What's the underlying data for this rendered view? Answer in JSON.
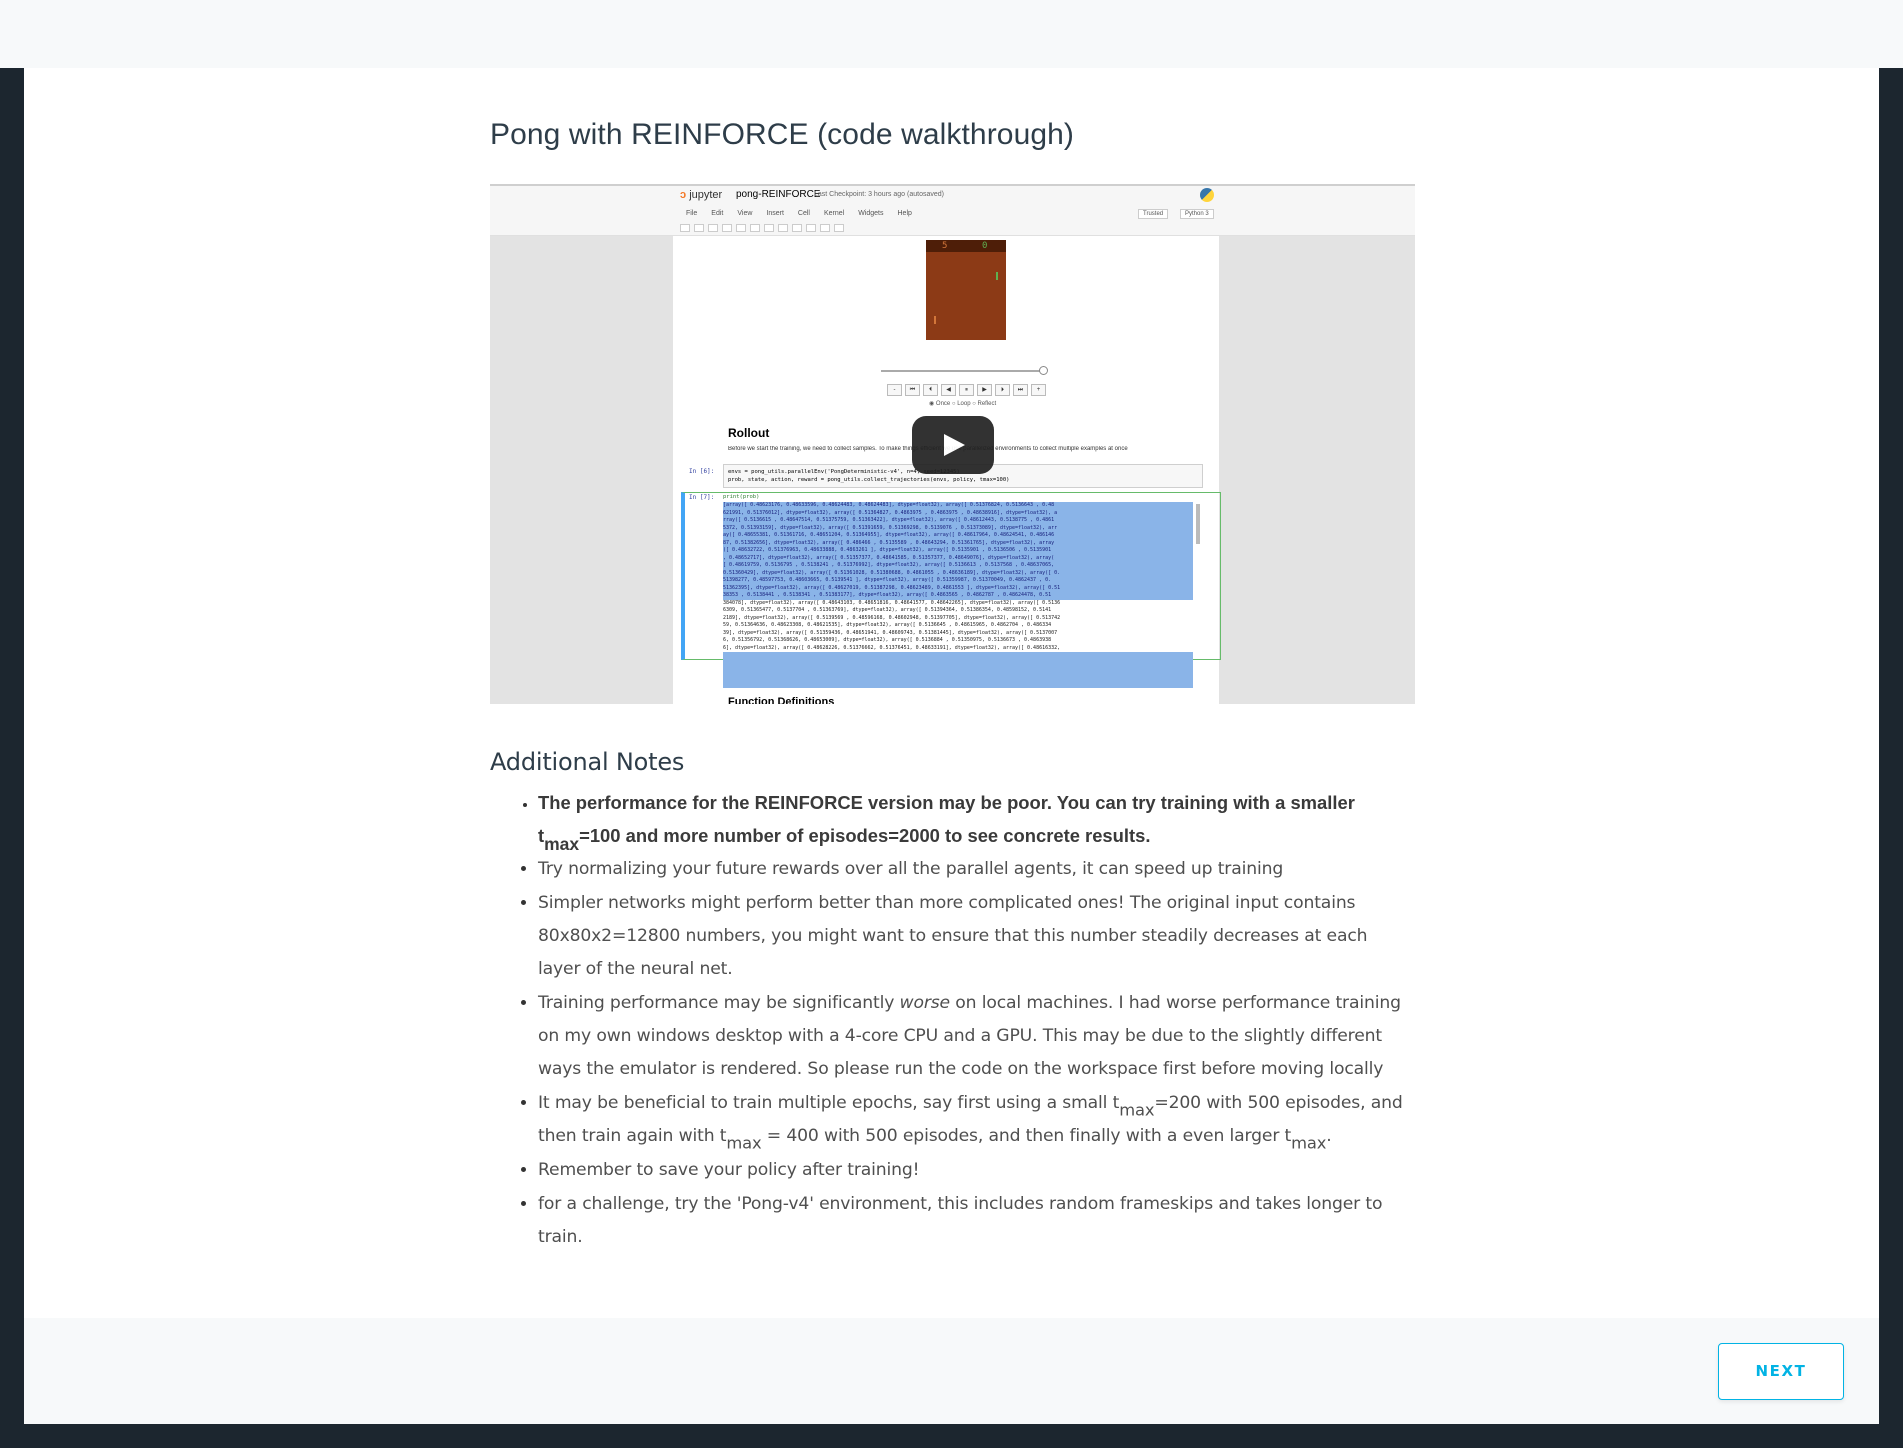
{
  "lesson": {
    "title": "Pong with REINFORCE (code walkthrough)"
  },
  "video": {
    "notebook": {
      "logo_text": "jupyter",
      "name": "pong-REINFORCE",
      "checkpoint": "Last Checkpoint: 3 hours ago  (autosaved)",
      "menu": [
        "File",
        "Edit",
        "View",
        "Insert",
        "Cell",
        "Kernel",
        "Widgets",
        "Help"
      ],
      "trusted": "Trusted",
      "kernel": "Python 3",
      "score_left": "5",
      "score_right": "0",
      "loop_options": "◉ Once ○ Loop ○ Reflect",
      "rollout_heading": "Rollout",
      "rollout_desc": "Before we start the training, we need to collect samples. To make things efficient we use parallelized environments to collect multiple examples at once",
      "cell4_prompt": "In [6]:",
      "cell4_line1": "envs = pong_utils.parallelEnv('PongDeterministic-v4', n=4, seed=12345)",
      "cell4_line2": "prob, state, action, reward = pong_utils.collect_trajectories(envs, policy, tmax=100)",
      "cell7_prompt": "In [7]:",
      "cell7_code": "print(prob)",
      "output_lines": [
        "[array([ 0.48623176,  0.48633596,  0.48624483,  0.48624483], dtype=float32), array([ 0.51376824,  0.5136643 ,  0.48",
        "621991,  0.51376012], dtype=float32), array([ 0.51364827,  0.4863975 ,  0.4863975 ,  0.48638916], dtype=float32), a",
        "rray([ 0.5136615 ,  0.48647514,  0.51375759,  0.51363422], dtype=float32), array([ 0.48612443,  0.5138775 ,  0.4861",
        "5372,  0.51393159], dtype=float32), array([ 0.51391659,  0.51369298,  0.5139076 ,  0.51373089], dtype=float32), arr",
        "ay([ 0.48655381,  0.51361716,  0.48651204,  0.51364955], dtype=float32), array([ 0.48617964,  0.48624541,  0.486146",
        "87,  0.51382656], dtype=float32), array([ 0.486466  ,  0.5135589 ,  0.48643294,  0.51361765], dtype=float32), array",
        "([ 0.48632722,  0.51376963,  0.48633888,  0.4863261 ], dtype=float32), array([ 0.5135901 ,  0.5136506 ,  0.5135901",
        ",  0.48652717], dtype=float32), array([ 0.51357377,  0.48641585,  0.51357377,  0.48649076], dtype=float32), array(",
        "[ 0.48619759,  0.5136795 ,  0.5138241 ,  0.51376992], dtype=float32), array([ 0.5136613 ,  0.5137568 ,  0.48637065,",
        "  0.51360429], dtype=float32), array([ 0.51361028,  0.51380688,  0.4861055 ,  0.48636189], dtype=float32), array([ 0.",
        "51398277,  0.48597753,  0.48603665,  0.5139541 ], dtype=float32), array([ 0.51359987,  0.51370049,  0.4862437 ,  0.",
        "51362395], dtype=float32), array([ 0.48627019,  0.51387298,  0.48623489,  0.4861553 ], dtype=float32), array([ 0.51",
        "38353 ,  0.5138441 ,  0.5138341 ,  0.51383177], dtype=float32), array([ 0.4863565 ,  0.4862787 ,  0.48624478,  0.51",
        "384078], dtype=float32), array([ 0.48643103,  0.48651816,  0.48641577,  0.48642265], dtype=float32), array([ 0.5136",
        "6309,  0.51365477,  0.5137704 ,  0.51363769], dtype=float32), array([ 0.51394364,  0.51386354,  0.48598152,  0.5141",
        "2189], dtype=float32), array([ 0.5139569 ,  0.48596168,  0.48602948,  0.51397705], dtype=float32), array([ 0.513742",
        "59,  0.51364636,  0.48623308,  0.48621535], dtype=float32), array([ 0.5136645 ,  0.48615965,  0.4862704 ,  0.486334",
        "39], dtype=float32), array([ 0.51359436,  0.48651941,  0.48609743,  0.51381445], dtype=float32), array([ 0.5137007",
        "6,  0.51356792,  0.51368626,  0.48653009], dtype=float32), array([ 0.5136884 ,  0.51350975,  0.5136673 ,  0.4863938",
        "6], dtype=float32), array([ 0.48628226,  0.51376662,  0.51376451,  0.48633191], dtype=float32), array([ 0.48616332,"
      ],
      "function_heading": "Function Definitions"
    }
  },
  "notes": {
    "heading": "Additional Notes",
    "items": [
      {
        "pre": "The performance for the REINFORCE version may be poor. You can try training with a smaller t",
        "sub1": "max",
        "post": "=100 and more number of episodes=2000 to see concrete results."
      },
      {
        "text": "Try normalizing your future rewards over all the parallel agents, it can speed up training"
      },
      {
        "text": "Simpler networks might perform better than more complicated ones! The original input contains 80x80x2=12800 numbers, you might want to ensure that this number steadily decreases at each layer of the neural net."
      },
      {
        "pre": "Training performance may be significantly ",
        "em": "worse",
        "post": " on local machines. I had worse performance training on my own windows desktop with a 4-core CPU and a GPU. This may be due to the slightly different ways the emulator is rendered. So please run the code on the workspace first before moving locally"
      },
      {
        "a": "It may be beneficial to train multiple epochs, say first using a small t",
        "sub1": "max",
        "b": "=200 with 500 episodes, and then train again with t",
        "sub2": "max",
        "c": " = 400 with 500 episodes, and then finally with a even larger t",
        "sub3": "max",
        "d": "."
      },
      {
        "text": "Remember to save your policy after training!"
      },
      {
        "text": "for a challenge, try the 'Pong-v4' environment, this includes random frameskips and takes longer to train."
      }
    ]
  },
  "footer": {
    "next_label": "NEXT"
  },
  "colors": {
    "accent": "#02b3e4",
    "background": "#1c262f",
    "text": "#4f4f4f"
  }
}
